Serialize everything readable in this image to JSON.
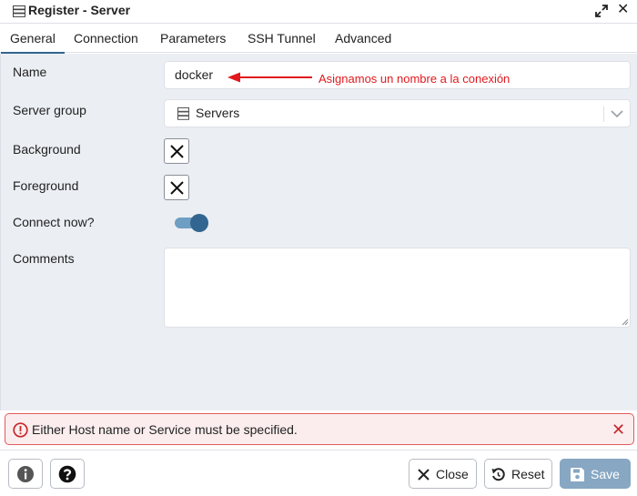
{
  "window": {
    "title": "Register - Server"
  },
  "tabs": [
    {
      "label": "General",
      "active": true
    },
    {
      "label": "Connection",
      "active": false
    },
    {
      "label": "Parameters",
      "active": false
    },
    {
      "label": "SSH Tunnel",
      "active": false
    },
    {
      "label": "Advanced",
      "active": false
    }
  ],
  "form": {
    "name_label": "Name",
    "name_value": "docker",
    "annotation": "Asignamos un nombre a la conexión",
    "server_group_label": "Server group",
    "server_group_value": "Servers",
    "background_label": "Background",
    "foreground_label": "Foreground",
    "connect_now_label": "Connect now?",
    "connect_now_enabled": true,
    "comments_label": "Comments",
    "comments_value": ""
  },
  "error": {
    "message": "Either Host name or Service must be specified."
  },
  "footer": {
    "close_label": "Close",
    "reset_label": "Reset",
    "save_label": "Save"
  },
  "colors": {
    "accent": "#326690",
    "error_border": "#e05a5f",
    "annotation": "#e0191e",
    "save_button": "#87a7c3"
  },
  "icons": [
    "server-icon",
    "expand-icon",
    "close-icon",
    "database-icon",
    "chevron-down-icon",
    "x-icon",
    "error-icon",
    "info-icon",
    "help-icon",
    "reset-icon",
    "save-icon"
  ]
}
